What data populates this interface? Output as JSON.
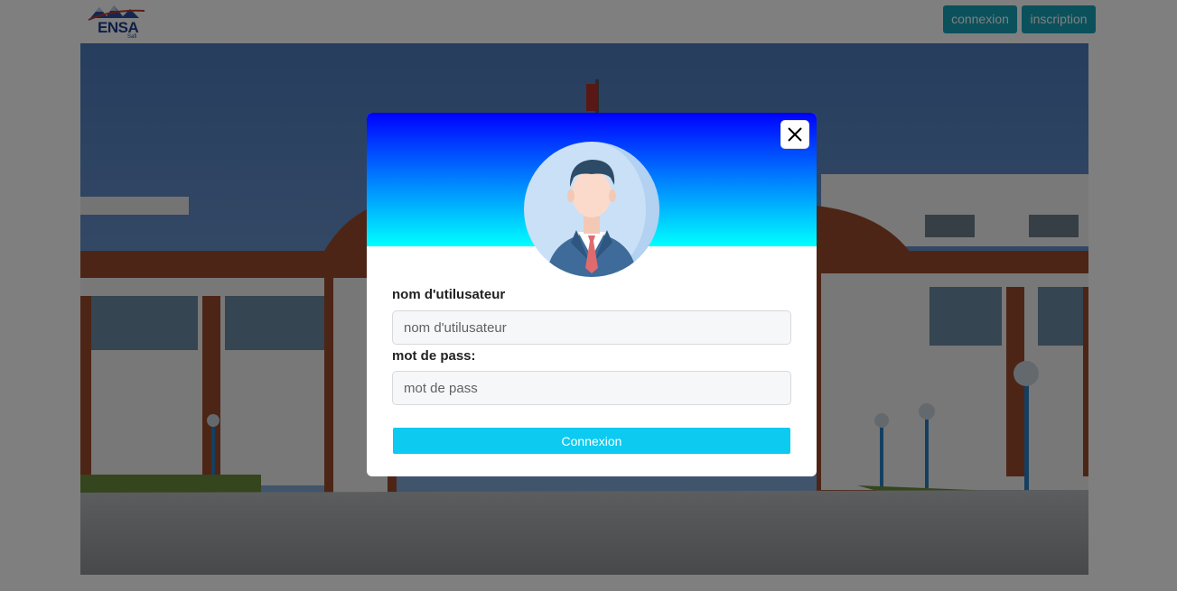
{
  "navbar": {
    "logo_text": "ENSA",
    "logo_sub": "Safi",
    "login_label": "connexion",
    "signup_label": "inscription"
  },
  "modal": {
    "username_label": "nom d'utilusateur",
    "username_placeholder": "nom d'utilusateur",
    "password_label": "mot de pass:",
    "password_placeholder": "mot de pass",
    "submit_label": "Connexion"
  },
  "colors": {
    "header_gradient_top": "#0000ff",
    "header_gradient_bottom": "#00ffff",
    "nav_button": "#17a2b8",
    "submit_button": "#0dcaf0"
  },
  "icons": [
    "logo",
    "close-icon",
    "user-avatar-icon"
  ]
}
